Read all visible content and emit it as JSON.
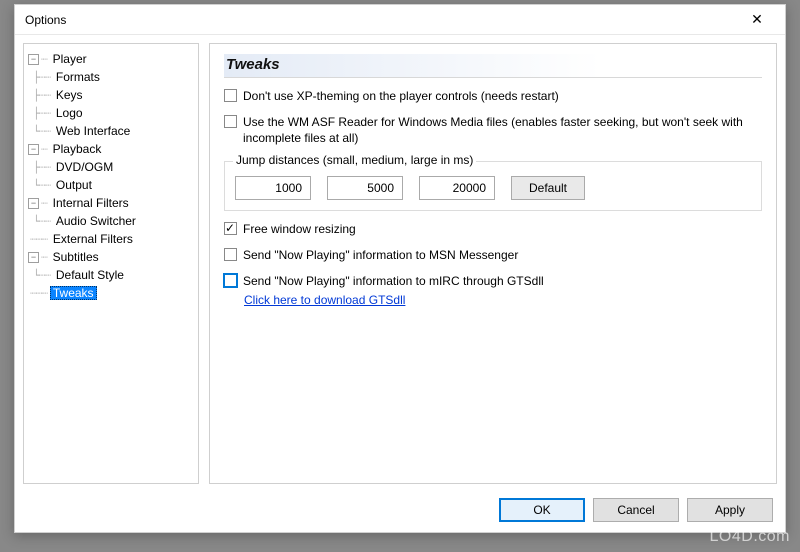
{
  "window": {
    "title": "Options",
    "close_glyph": "✕"
  },
  "tree": {
    "player": {
      "label": "Player",
      "children": {
        "formats": {
          "label": "Formats"
        },
        "keys": {
          "label": "Keys"
        },
        "logo": {
          "label": "Logo"
        },
        "web": {
          "label": "Web Interface"
        }
      }
    },
    "playback": {
      "label": "Playback",
      "children": {
        "dvd": {
          "label": "DVD/OGM"
        },
        "output": {
          "label": "Output"
        }
      }
    },
    "ifilters": {
      "label": "Internal Filters",
      "children": {
        "audio": {
          "label": "Audio Switcher"
        }
      }
    },
    "efilters": {
      "label": "External Filters"
    },
    "subtitles": {
      "label": "Subtitles",
      "children": {
        "style": {
          "label": "Default Style"
        }
      }
    },
    "tweaks": {
      "label": "Tweaks"
    }
  },
  "panel": {
    "title": "Tweaks",
    "cb_xp": "Don't use XP-theming on the player controls (needs restart)",
    "cb_asf": "Use the WM ASF Reader for Windows Media files (enables faster seeking, but won't seek with incomplete files at all)",
    "jump_group": "Jump distances (small, medium, large in ms)",
    "jump_small": "1000",
    "jump_medium": "5000",
    "jump_large": "20000",
    "default_btn": "Default",
    "cb_resize": "Free window resizing",
    "cb_msn": "Send \"Now Playing\" information to MSN Messenger",
    "cb_mirc": "Send \"Now Playing\" information to mIRC through GTSdll",
    "link_gtsdll": "Click here to download GTSdll"
  },
  "buttons": {
    "ok": "OK",
    "cancel": "Cancel",
    "apply": "Apply"
  },
  "watermark": "LO4D.com"
}
